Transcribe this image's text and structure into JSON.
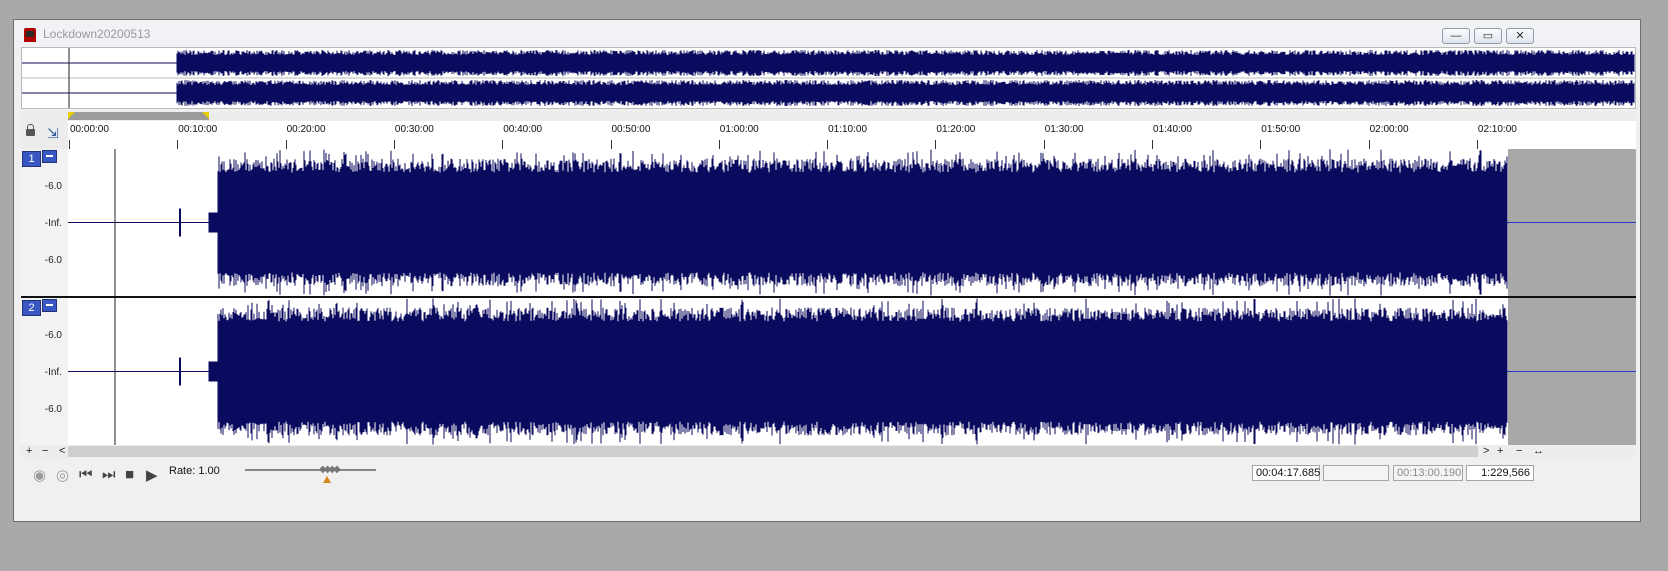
{
  "window": {
    "title": "Lockdown20200513",
    "buttons": {
      "minimize": "—",
      "restore": "▭",
      "close": "✕"
    }
  },
  "ruler": {
    "labels": [
      "00:00:00",
      "00:10:00",
      "00:20:00",
      "00:30:00",
      "00:40:00",
      "00:50:00",
      "01:00:00",
      "01:10:00",
      "01:20:00",
      "01:30:00",
      "01:40:00",
      "01:50:00",
      "02:00:00",
      "02:10:00"
    ]
  },
  "tracks": [
    {
      "number": "1",
      "db_labels": [
        "-6.0",
        "-Inf.",
        "-6.0"
      ]
    },
    {
      "number": "2",
      "db_labels": [
        "-6.0",
        "-Inf.",
        "-6.0"
      ]
    }
  ],
  "colors": {
    "waveform": "#0a0a5e",
    "track_button": "#3a58c2",
    "selection_marker": "#e8d000"
  },
  "bottom_controls": {
    "add": "+",
    "remove": "−",
    "scroll_left": "<",
    "scroll_right": ">",
    "zoom_in": "+",
    "zoom_out": "−",
    "zoom_fit": "↔"
  },
  "transport": {
    "rate_label": "Rate: 1.00",
    "cursor_position": "00:04:17.685",
    "selection_length": "",
    "total_length": "00:13:00.190",
    "zoom_ratio": "1:229,566"
  },
  "icons": [
    "app-icon",
    "lock-icon",
    "snap-icon",
    "record-icon",
    "loop-icon",
    "skip-start-icon",
    "skip-end-icon",
    "stop-icon",
    "play-icon"
  ]
}
